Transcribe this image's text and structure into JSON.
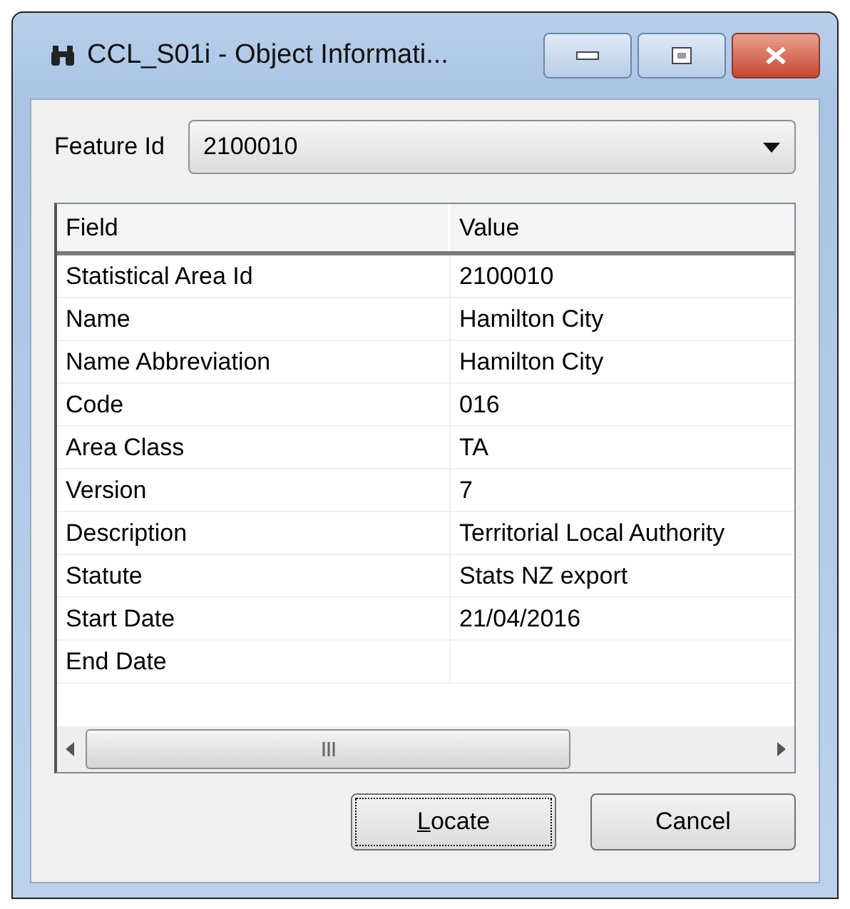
{
  "window": {
    "title": "CCL_S01i - Object Informati..."
  },
  "feature_id": {
    "label": "Feature Id",
    "value": "2100010"
  },
  "table": {
    "columns": [
      "Field",
      "Value"
    ],
    "rows": [
      {
        "field": "Statistical Area Id",
        "value": "2100010"
      },
      {
        "field": "Name",
        "value": "Hamilton City"
      },
      {
        "field": "Name Abbreviation",
        "value": "Hamilton City"
      },
      {
        "field": "Code",
        "value": "016"
      },
      {
        "field": "Area Class",
        "value": "TA"
      },
      {
        "field": "Version",
        "value": "7"
      },
      {
        "field": "Description",
        "value": "Territorial Local Authority"
      },
      {
        "field": "Statute",
        "value": "Stats NZ export"
      },
      {
        "field": "Start Date",
        "value": "21/04/2016"
      },
      {
        "field": "End Date"
      }
    ]
  },
  "buttons": [
    {
      "label": "Locate",
      "access_key": true,
      "focused": true
    },
    {
      "label": "Cancel",
      "focused": false
    }
  ]
}
